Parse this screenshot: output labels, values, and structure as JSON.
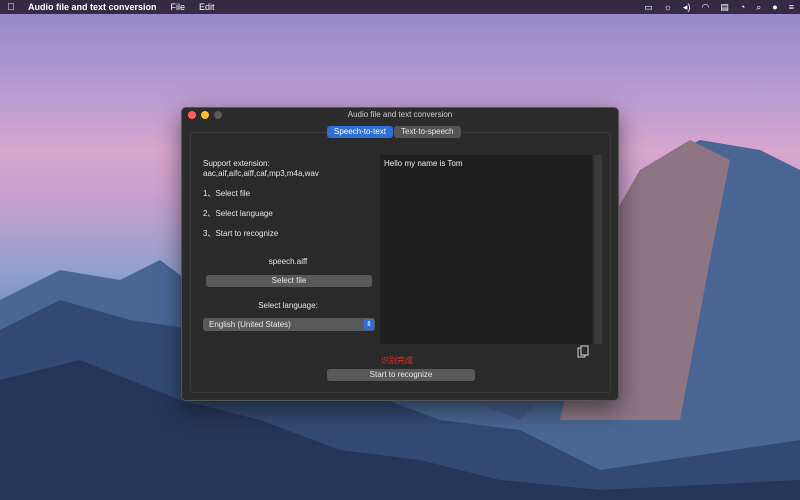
{
  "menubar": {
    "app_name": "Audio file and text conversion",
    "menus": [
      "File",
      "Edit"
    ]
  },
  "window": {
    "title": "Audio file and text conversion",
    "tabs": [
      {
        "label": "Speech-to-text",
        "active": true
      },
      {
        "label": "Text-to-speech",
        "active": false
      }
    ],
    "support_heading": "Support extension:",
    "support_extensions": "aac,aif,aifc,aiff,caf,mp3,m4a,wav",
    "steps": [
      "1、Select file",
      "2、Select language",
      "3、Start to recognize"
    ],
    "file_name": "speech.aiff",
    "select_file_label": "Select file",
    "select_language_label": "Select language:",
    "language_value": "English (United States)",
    "transcript_text": "Hello my name is Tom",
    "status_text": "识别完成",
    "status_color": "#e0312c",
    "start_button_label": "Start to recognize",
    "accent_color": "#2e6fd8"
  }
}
